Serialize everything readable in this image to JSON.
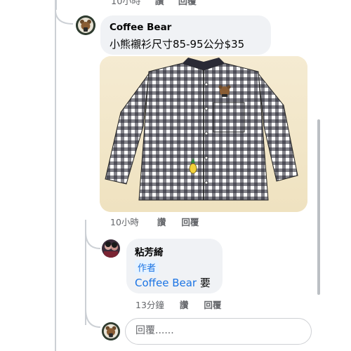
{
  "top_meta": {
    "time": "10小時",
    "like": "讚",
    "reply": "回覆"
  },
  "comment": {
    "author": "Coffee Bear",
    "text": "小熊襯衫尺寸85-95公分$35",
    "meta": {
      "time": "10小時",
      "like": "讚",
      "reply": "回覆"
    }
  },
  "reply": {
    "author": "粘芳綺",
    "badge": "作者",
    "mention": "Coffee Bear",
    "text_suffix": " 要",
    "meta": {
      "time": "13分鐘",
      "like": "讚",
      "reply": "回覆"
    }
  },
  "reply_input": {
    "placeholder": "回覆......"
  },
  "colors": {
    "bubble": "#f0f2f5",
    "link": "#1b74e4",
    "meta": "#65676b",
    "thread_line": "#ccd0d5"
  }
}
